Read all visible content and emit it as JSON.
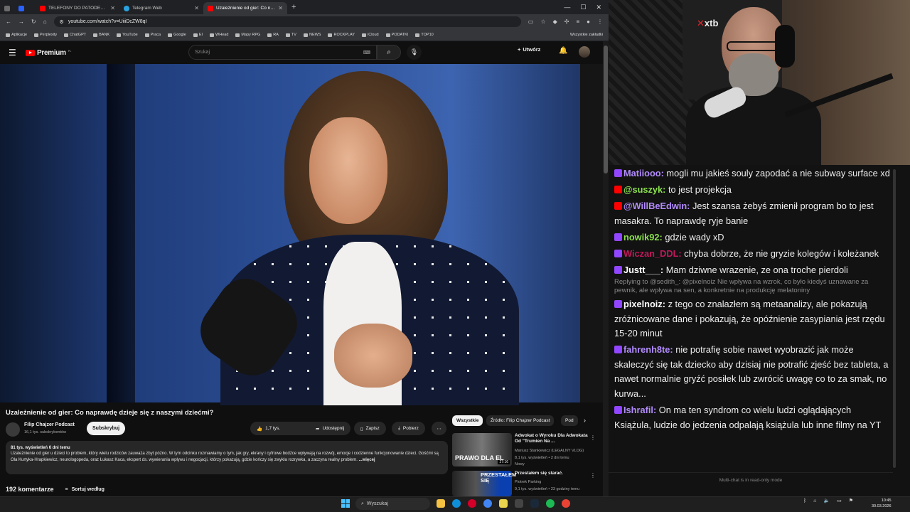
{
  "browser": {
    "tabs": [
      {
        "label": "",
        "color": "#6b6b6b"
      },
      {
        "label": "",
        "color": "#2962ff"
      },
      {
        "label": "TELEFONY DO PATODEWELOPE",
        "color": "#ff0000"
      },
      {
        "label": "Telegram Web",
        "color": "#2aa3e0"
      },
      {
        "label": "Uzależnienie od gier: Co napraw",
        "color": "#ff0000"
      }
    ],
    "url": "youtube.com/watch?v=UiiiDcZW8qI",
    "bookmarks": [
      "Aplikacje",
      "Perplexity",
      "ChatGPT",
      "BANK",
      "YouTube",
      "Praca",
      "Google",
      "EI",
      "WHead",
      "Mapy RPG",
      "RA",
      "TV",
      "NEWS",
      "ROCKPLAY",
      "iCloud",
      "PODATKI",
      "TOP10"
    ],
    "bookmarks_right": "Wszystkie zakładki"
  },
  "youtube": {
    "logo": "Premium",
    "logo_sup": "PL",
    "search_placeholder": "Szukaj",
    "create_label": "Utwórz",
    "video_title": "Uzależnienie od gier: Co naprawdę dzieje się z naszymi dziećmi?",
    "channel_name": "Filip Chajzer Podcast",
    "subscribers": "16,1 tys. subskrybentów",
    "subscribe_label": "Subskrybuj",
    "likes": "1,7 tys.",
    "share_label": "Udostępnij",
    "save_label": "Zapisz",
    "download_label": "Pobierz",
    "desc_meta": "81 tys. wyświetleń  6 dni temu",
    "desc_text": "Uzależnienie od gier u dzieci to problem, który wielu rodziców zauważa zbyt późno. W tym odcinku rozmawiamy o tym, jak gry, ekrany i cyfrowe bodźce wpływają na rozwój, emocje i codzienne funkcjonowanie dzieci. Gośćmi są Ola Kurtyka-Hrapkiewicz, neurologopeda, oraz Łukasz Kaca, ekspert ds. wywierania wpływu i negocjacji, którzy pokazują, gdzie kończy się zwykła rozrywka, a zaczyna realny problem.",
    "desc_more": "...więcej",
    "comments_count": "192 komentarze",
    "sort_label": "Sortuj według",
    "chips": [
      "Wszystkie",
      "Źródło: Filip Chajzer Podcast",
      "Pod"
    ],
    "recs": [
      {
        "title": "Adwokat o Wyroku Dla Adwokata Od \"Trumien Na ...",
        "channel": "Mariusz Stankiewicz (LEGALNY VLOG)",
        "meta": "8,1 tys. wyświetleń • 2 dni temu",
        "badge": "Nowy",
        "thumb_text": "PRAWO DLA EL",
        "duration": "27:16"
      },
      {
        "title": "Przestałem się starać.",
        "channel": "Piotrek Parking",
        "meta": "9,1 tys. wyświetleń • 23 godziny temu",
        "badge": "",
        "thumb_text": "PRZESTAŁEM SIĘ",
        "duration": ""
      }
    ]
  },
  "cam": {
    "brand": "xtb"
  },
  "chat": {
    "messages": [
      {
        "user": "Matiiooo:",
        "user_color": "#b28cff",
        "icon": "#9146ff",
        "text": " mogli mu jakieś souly zapodać a nie subway surface xd"
      },
      {
        "user": "@suszyk:",
        "user_color": "#8be04e",
        "icon": "#ff0000",
        "text": " to jest projekcja"
      },
      {
        "user": "@WillBeEdwin:",
        "user_color": "#b28cff",
        "icon": "#ff0000",
        "text": " Jest szansa żebyś zmienił program bo to jest masakra. To naprawdę ryje banie"
      },
      {
        "user": "nowik92:",
        "user_color": "#8be04e",
        "icon": "#9146ff",
        "text": " gdzie wady xD"
      },
      {
        "user": "Wiczan_DDL:",
        "user_color": "#c2185b",
        "icon": "#9146ff",
        "text": " chyba dobrze, że nie gryzie kolegów i koleżanek"
      },
      {
        "user": "Justt___:",
        "user_color": "#ffffff",
        "icon": "#9146ff",
        "text": " Mam dziwne wrazenie, ze ona troche pierdoli",
        "reply": "Replying to @sedith_: @pixelnoiz Nie wpływa na wzrok, co było kiedyś uznawane za pewnik, ale wpływa na sen, a konkretnie na produkcję melatoniny"
      },
      {
        "user": "pixelnoiz:",
        "user_color": "#ffffff",
        "icon": "#9146ff",
        "text": "  z tego co znalazłem są metaanalizy, ale pokazują zróżnicowane dane i pokazują, że opóźnienie zasypiania jest rzędu 15-20 minut"
      },
      {
        "user": "fahrenh8te:",
        "user_color": "#b28cff",
        "icon": "#9146ff",
        "text": " nie potrafię sobie nawet wyobrazić jak może skaleczyć się tak dziecko aby dzisiaj nie potrafić zjeść bez tableta, a nawet normalnie gryźć posiłek lub zwrócić uwagę co to za smak, no kurwa..."
      },
      {
        "user": "Ishrafil:",
        "user_color": "#b28cff",
        "icon": "#9146ff",
        "text": " On ma ten syndrom co wielu ludzi oglądających Książula, ludzie do jedzenia odpalają książula lub inne filmy na YT"
      }
    ],
    "footer": "Multi-chat is in read-only mode"
  },
  "taskbar": {
    "search_placeholder": "Wyszukaj",
    "time": "10:45",
    "date": "30.03.2026"
  }
}
